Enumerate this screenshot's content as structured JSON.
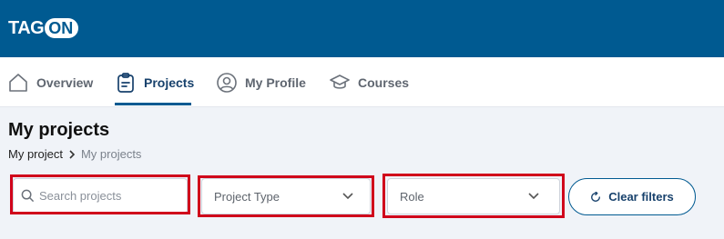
{
  "brand": {
    "logo_left": "TAG",
    "logo_right": "ON",
    "color": "#005a91"
  },
  "nav": {
    "tabs": [
      {
        "label": "Overview",
        "icon": "home-icon",
        "active": false
      },
      {
        "label": "Projects",
        "icon": "clipboard-icon",
        "active": true
      },
      {
        "label": "My Profile",
        "icon": "user-circle-icon",
        "active": false
      },
      {
        "label": "Courses",
        "icon": "graduation-cap-icon",
        "active": false
      }
    ]
  },
  "page": {
    "title": "My projects",
    "breadcrumb": {
      "parent": "My project",
      "current": "My projects"
    }
  },
  "filters": {
    "search": {
      "placeholder": "Search projects",
      "value": ""
    },
    "project_type": {
      "label": "Project Type"
    },
    "role": {
      "label": "Role"
    },
    "clear_label": "Clear filters"
  },
  "colors": {
    "highlight": "#d0021b",
    "accent": "#005a91",
    "background": "#f0f3f8"
  }
}
